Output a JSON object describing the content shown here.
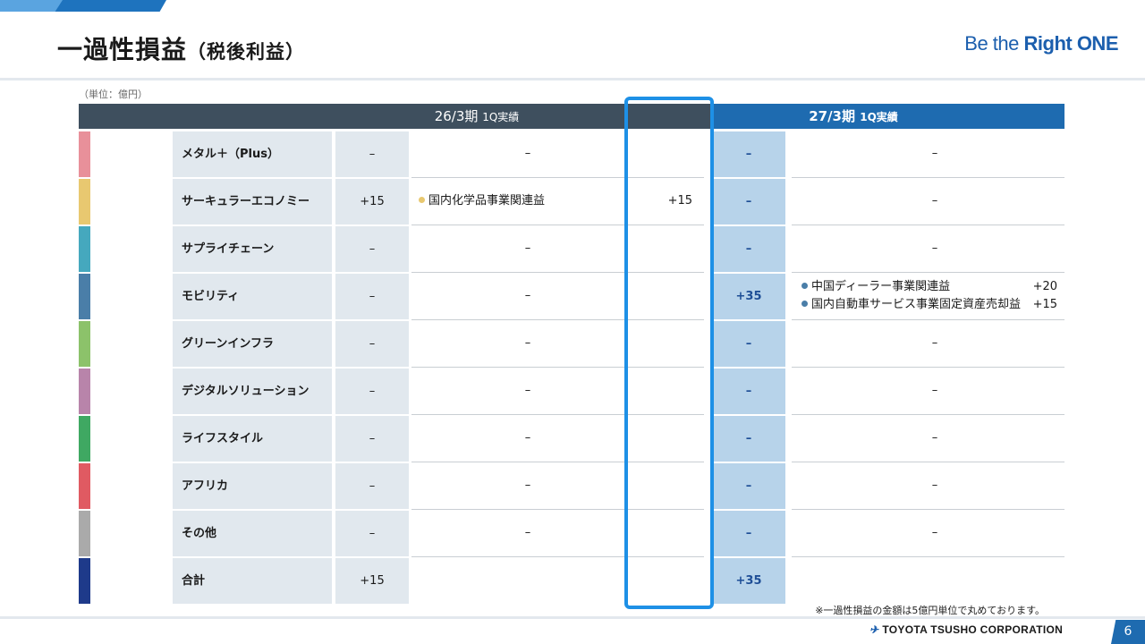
{
  "header": {
    "title": "一過性損益",
    "subtitle": "（税後利益）",
    "brand_regular": "Be the ",
    "brand_bold": "Right ONE"
  },
  "unit_note": "（単位：億円）",
  "columns": {
    "fy26_main": "26/3期",
    "fy26_sub": "1Q実績",
    "fy27_main": "27/3期",
    "fy27_sub": "1Q実績"
  },
  "rows": [
    {
      "name": "メタル＋（Plus）",
      "color": "#e8909a",
      "v26": "–",
      "d26": "–",
      "v27": "–",
      "d27": "–"
    },
    {
      "name": "サーキュラーエコノミー",
      "color": "#e8c870",
      "v26": "+15",
      "d26_item": "国内化学品事業関連益",
      "d26_amt": "+15",
      "d26_dot": "#e8c870",
      "v27": "–",
      "d27": "–"
    },
    {
      "name": "サプライチェーン",
      "color": "#45a8be",
      "v26": "–",
      "d26": "–",
      "v27": "–",
      "d27": "–"
    },
    {
      "name": "モビリティ",
      "color": "#4a7ea8",
      "v26": "–",
      "d26": "–",
      "v27": "+35",
      "d27_items": [
        {
          "label": "中国ディーラー事業関連益",
          "amt": "+20"
        },
        {
          "label": "国内自動車サービス事業固定資産売却益",
          "amt": "+15"
        }
      ],
      "d27_dot": "#4a7ea8"
    },
    {
      "name": "グリーンインフラ",
      "color": "#8cc26a",
      "v26": "–",
      "d26": "–",
      "v27": "–",
      "d27": "–"
    },
    {
      "name": "デジタルソリューション",
      "color": "#b884aa",
      "v26": "–",
      "d26": "–",
      "v27": "–",
      "d27": "–"
    },
    {
      "name": "ライフスタイル",
      "color": "#3fa862",
      "v26": "–",
      "d26": "–",
      "v27": "–",
      "d27": "–"
    },
    {
      "name": "アフリカ",
      "color": "#e05a62",
      "v26": "–",
      "d26": "–",
      "v27": "–",
      "d27": "–"
    },
    {
      "name": "その他",
      "color": "#aaaaaa",
      "v26": "–",
      "d26": "–",
      "v27": "–",
      "d27": "–"
    },
    {
      "name": "合計",
      "color": "#1e3a8a",
      "v26": "+15",
      "d26": "",
      "v27": "+35",
      "d27": ""
    }
  ],
  "footnote": "※一過性損益の金額は5億円単位で丸めております。",
  "footer": {
    "company": "TOYOTA TSUSHO CORPORATION",
    "page_number": "6"
  }
}
